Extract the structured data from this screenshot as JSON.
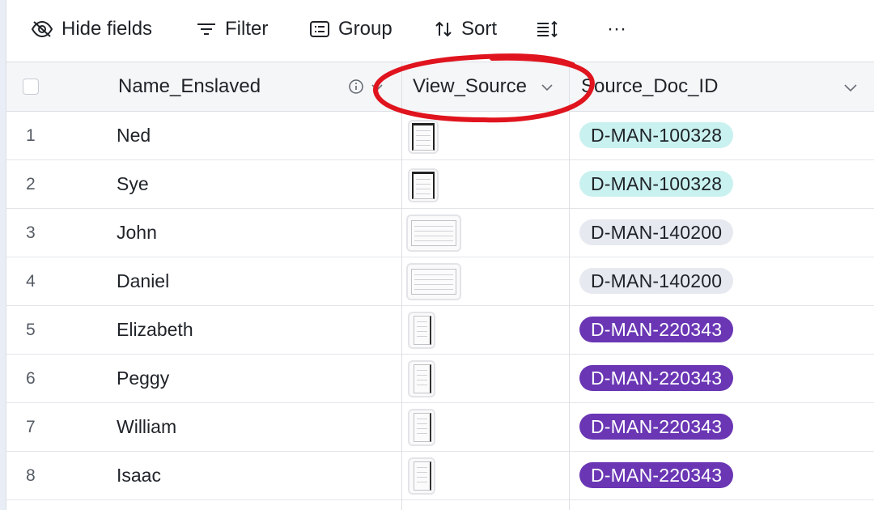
{
  "toolbar": {
    "hide_fields": "Hide fields",
    "filter": "Filter",
    "group": "Group",
    "sort": "Sort",
    "more": "···"
  },
  "columns": {
    "name": "Name_Enslaved",
    "view": "View_Source",
    "source": "Source_Doc_ID"
  },
  "rows": [
    {
      "num": "1",
      "name": "Ned",
      "doc_id": "D-MAN-100328",
      "tag_color": "teal",
      "thumb": "portrait-dark"
    },
    {
      "num": "2",
      "name": "Sye",
      "doc_id": "D-MAN-100328",
      "tag_color": "teal",
      "thumb": "portrait-dark"
    },
    {
      "num": "3",
      "name": "John",
      "doc_id": "D-MAN-140200",
      "tag_color": "gray",
      "thumb": "landscape"
    },
    {
      "num": "4",
      "name": "Daniel",
      "doc_id": "D-MAN-140200",
      "tag_color": "gray",
      "thumb": "landscape"
    },
    {
      "num": "5",
      "name": "Elizabeth",
      "doc_id": "D-MAN-220343",
      "tag_color": "purple",
      "thumb": "narrow"
    },
    {
      "num": "6",
      "name": "Peggy",
      "doc_id": "D-MAN-220343",
      "tag_color": "purple",
      "thumb": "narrow"
    },
    {
      "num": "7",
      "name": "William",
      "doc_id": "D-MAN-220343",
      "tag_color": "purple",
      "thumb": "narrow"
    },
    {
      "num": "8",
      "name": "Isaac",
      "doc_id": "D-MAN-220343",
      "tag_color": "purple",
      "thumb": "narrow"
    }
  ],
  "colors": {
    "teal_tag": "#c9f1ef",
    "gray_tag": "#e6e9ef",
    "purple_tag": "#6a36b4",
    "annotation_red": "#e0141e"
  },
  "icons": {
    "hide_fields": "eye-slash-icon",
    "filter": "filter-lines-icon",
    "group": "group-list-icon",
    "sort": "sort-arrows-icon",
    "row_height": "row-height-icon",
    "info": "info-icon",
    "dropdown": "chevron-down-icon"
  }
}
